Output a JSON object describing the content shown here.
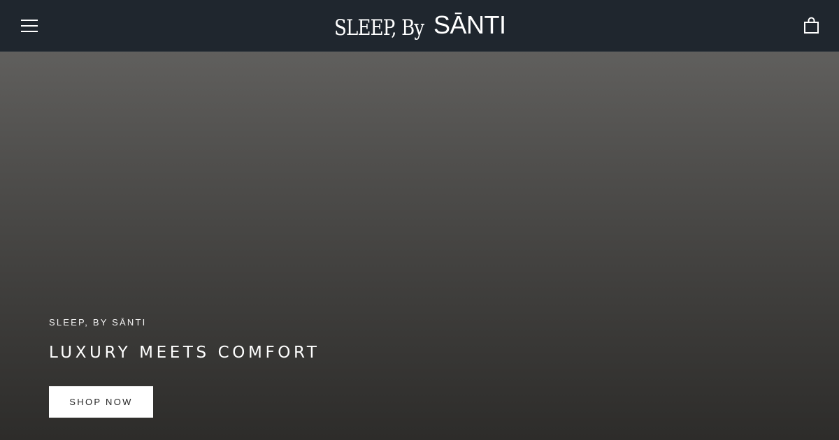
{
  "header": {
    "menu_icon": "hamburger-menu-icon",
    "logo_light": "SLEEP, By",
    "logo_bold": "SĀNTI",
    "cart_icon": "shopping-bag-icon"
  },
  "hero": {
    "eyebrow": "SLEEP, BY SĀNTI",
    "headline": "LUXURY MEETS COMFORT",
    "cta_label": "SHOP NOW"
  },
  "colors": {
    "header_bg": "#1f262e",
    "hero_top": "#605f5d",
    "hero_bottom": "#2d2c2a",
    "button_bg": "#ffffff",
    "button_text": "#262626",
    "text": "#ffffff"
  }
}
